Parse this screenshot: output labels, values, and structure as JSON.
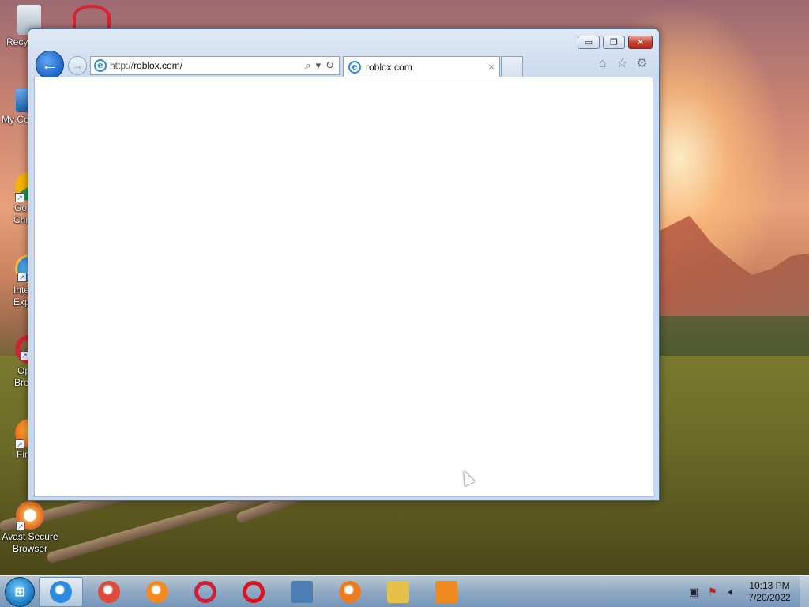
{
  "desktop": {
    "icons": [
      {
        "label": "Recycle Bin",
        "icon": "recycle-bin-icon"
      },
      {
        "label": "My Computer",
        "icon": "computer-icon"
      },
      {
        "label": "Google Chrome",
        "icon": "chrome-icon"
      },
      {
        "label": "Internet Explorer",
        "icon": "internet-explorer-icon"
      },
      {
        "label": "Opera Browser",
        "icon": "opera-icon"
      },
      {
        "label": "Firefox",
        "icon": "firefox-icon"
      },
      {
        "label": "Avast Secure Browser",
        "icon": "avast-browser-icon"
      }
    ],
    "visible_labels": {
      "recycle": "Recy",
      "computer": "My Co",
      "chrome_1": "Go",
      "chrome_2": "Chr",
      "ie_1": "Inte",
      "ie_2": "Exp",
      "opera_1": "Op",
      "opera_2": "Bro",
      "firefox": "Fir",
      "avast_1": "Avast Secure",
      "avast_2": "Browser"
    }
  },
  "browser": {
    "url_prefix": "http://",
    "url_host": "roblox.com/",
    "tab_title": "roblox.com",
    "tab_close": "×",
    "controls": {
      "minimize": "▭",
      "maximize": "❐",
      "close": "✕"
    },
    "icons": {
      "back": "←",
      "forward": "→",
      "search": "⌕",
      "dropdown": "▾",
      "refresh": "↻",
      "home": "⌂",
      "favorites": "☆",
      "settings": "⚙"
    }
  },
  "taskbar": {
    "apps": [
      {
        "name": "internet-explorer",
        "color": "#2b8be0",
        "active": true
      },
      {
        "name": "chrome",
        "color": "#e04a3a"
      },
      {
        "name": "firefox",
        "color": "#f58a1f"
      },
      {
        "name": "opera-gx",
        "color": "#d01e38"
      },
      {
        "name": "opera",
        "color": "#e0101e"
      },
      {
        "name": "media-center",
        "color": "#4d7fb6"
      },
      {
        "name": "avast-browser",
        "color": "#f07a1e"
      },
      {
        "name": "file-explorer",
        "color": "#e6c14a"
      },
      {
        "name": "media-player",
        "color": "#f08a1e"
      }
    ],
    "clock_time": "10:13 PM",
    "clock_date": "7/20/2022"
  }
}
